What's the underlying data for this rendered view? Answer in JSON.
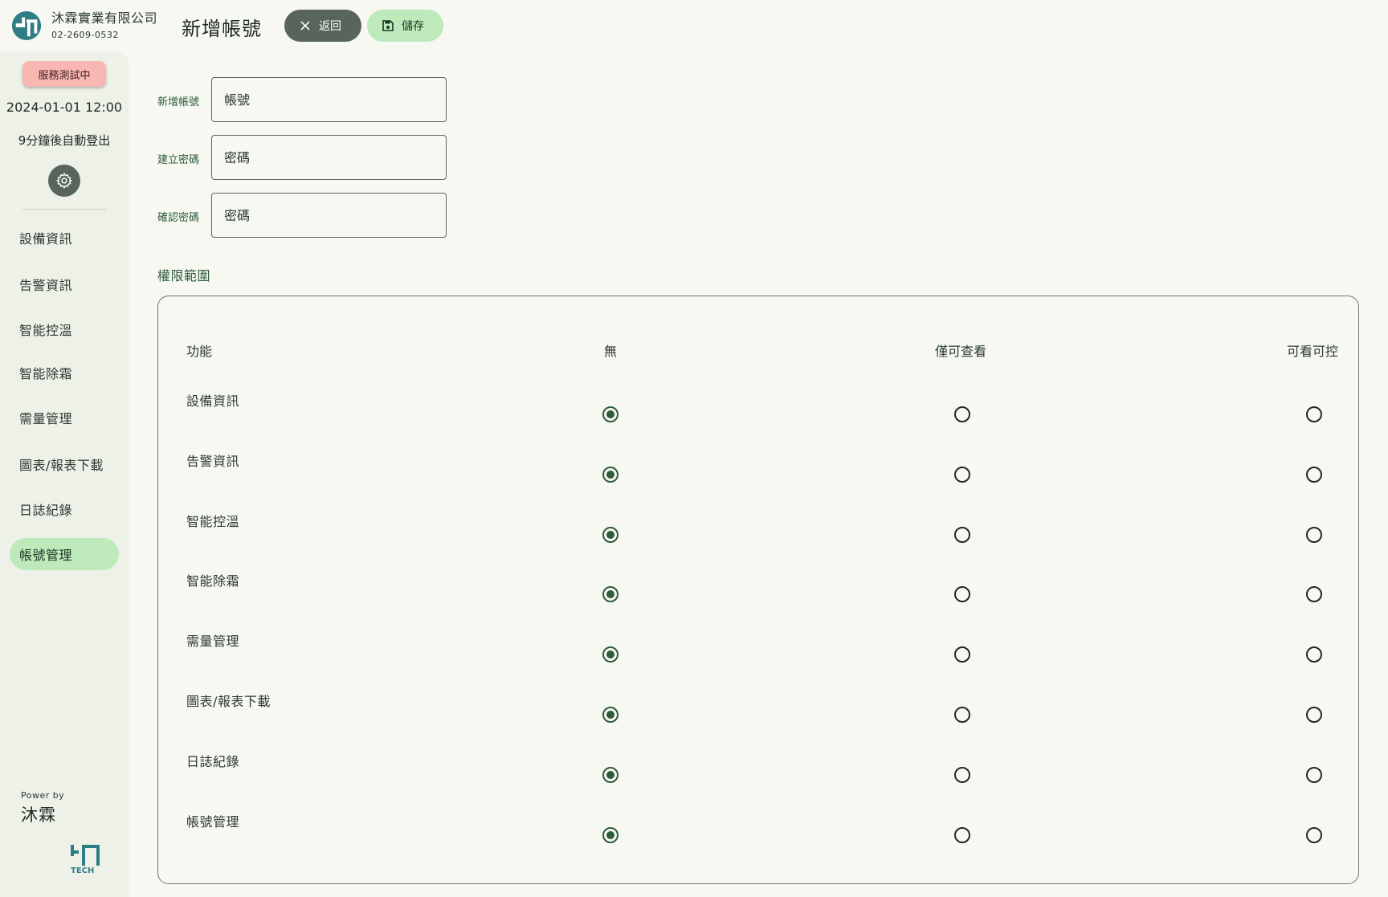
{
  "brand": {
    "name": "沐霖實業有限公司",
    "phone": "02-2609-0532"
  },
  "header": {
    "title": "新增帳號",
    "back_label": "返回",
    "save_label": "儲存"
  },
  "sidebar": {
    "status": "服務測試中",
    "datetime": "2024-01-01 12:00",
    "auto_logout": "9分鐘後自動登出",
    "items": [
      {
        "label": "設備資訊",
        "active": false
      },
      {
        "label": "告警資訊",
        "active": false
      },
      {
        "label": "智能控溫",
        "active": false
      },
      {
        "label": "智能除霜",
        "active": false
      },
      {
        "label": "需量管理",
        "active": false
      },
      {
        "label": "圖表/報表下載",
        "active": false
      },
      {
        "label": "日誌紀錄",
        "active": false
      },
      {
        "label": "帳號管理",
        "active": true
      }
    ],
    "powered_by": "Power by",
    "powered_name": "沐霖",
    "tech_label": "TECH"
  },
  "form": {
    "account": {
      "label": "新增帳號",
      "placeholder": "帳號",
      "value": ""
    },
    "password": {
      "label": "建立密碼",
      "placeholder": "密碼",
      "value": ""
    },
    "confirm": {
      "label": "確認密碼",
      "placeholder": "密碼",
      "value": ""
    }
  },
  "permissions": {
    "title": "權限範圍",
    "headers": [
      "功能",
      "無",
      "僅可查看",
      "可看可控"
    ],
    "rows": [
      {
        "name": "設備資訊",
        "selected": 0
      },
      {
        "name": "告警資訊",
        "selected": 0
      },
      {
        "name": "智能控溫",
        "selected": 0
      },
      {
        "name": "智能除霜",
        "selected": 0
      },
      {
        "name": "需量管理",
        "selected": 0
      },
      {
        "name": "圖表/報表下載",
        "selected": 0
      },
      {
        "name": "日誌紀錄",
        "selected": 0
      },
      {
        "name": "帳號管理",
        "selected": 0
      }
    ]
  },
  "colors": {
    "accent": "#2e5c3a",
    "active_bg": "#bde9bb",
    "dark_btn": "#57655c",
    "status_bg": "#f9b7b3",
    "background": "#f6f8f1"
  }
}
